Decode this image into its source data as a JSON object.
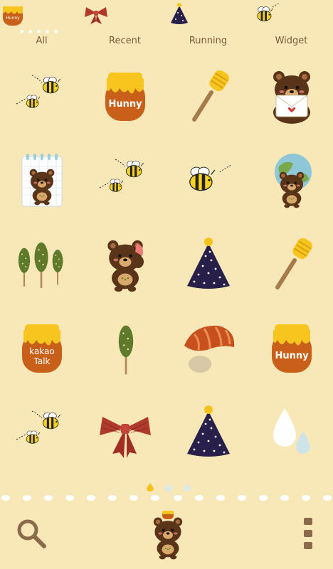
{
  "tabs": [
    {
      "label": "All",
      "icon": "honey-pot-icon"
    },
    {
      "label": "Recent",
      "icon": "ribbon-icon"
    },
    {
      "label": "Running",
      "icon": "party-hat-icon"
    },
    {
      "label": "Widget",
      "icon": "bee-icon"
    }
  ],
  "honey_labels": {
    "hunny": "Hunny",
    "kakao1": "kakao",
    "kakao2": "Talk",
    "small": "Hunny"
  },
  "apps": [
    {
      "icon": "bees-icon"
    },
    {
      "icon": "honey-pot-icon"
    },
    {
      "icon": "honey-dipper-icon"
    },
    {
      "icon": "bear-letter-icon"
    },
    {
      "icon": "bear-notepad-icon"
    },
    {
      "icon": "bees-icon"
    },
    {
      "icon": "bee-icon"
    },
    {
      "icon": "bear-globe-icon"
    },
    {
      "icon": "trees-icon"
    },
    {
      "icon": "bear-phone-icon"
    },
    {
      "icon": "party-hat-icon"
    },
    {
      "icon": "honey-dipper-icon"
    },
    {
      "icon": "kakao-honey-pot-icon"
    },
    {
      "icon": "tree-icon"
    },
    {
      "icon": "mushroom-icon"
    },
    {
      "icon": "honey-pot-icon"
    },
    {
      "icon": "bees-icon"
    },
    {
      "icon": "ribbon-icon"
    },
    {
      "icon": "party-hat-icon"
    },
    {
      "icon": "water-drops-icon"
    }
  ],
  "pager": {
    "current": 1,
    "total": 3
  },
  "dock": {
    "left": "search-icon",
    "center": "bear-home-icon",
    "right": "menu-icon"
  },
  "colors": {
    "background": "#f8e8b8",
    "honey": "#f7c51e",
    "pot": "#c8601a",
    "bear": "#5a3418",
    "text": "#7a5a3a"
  }
}
